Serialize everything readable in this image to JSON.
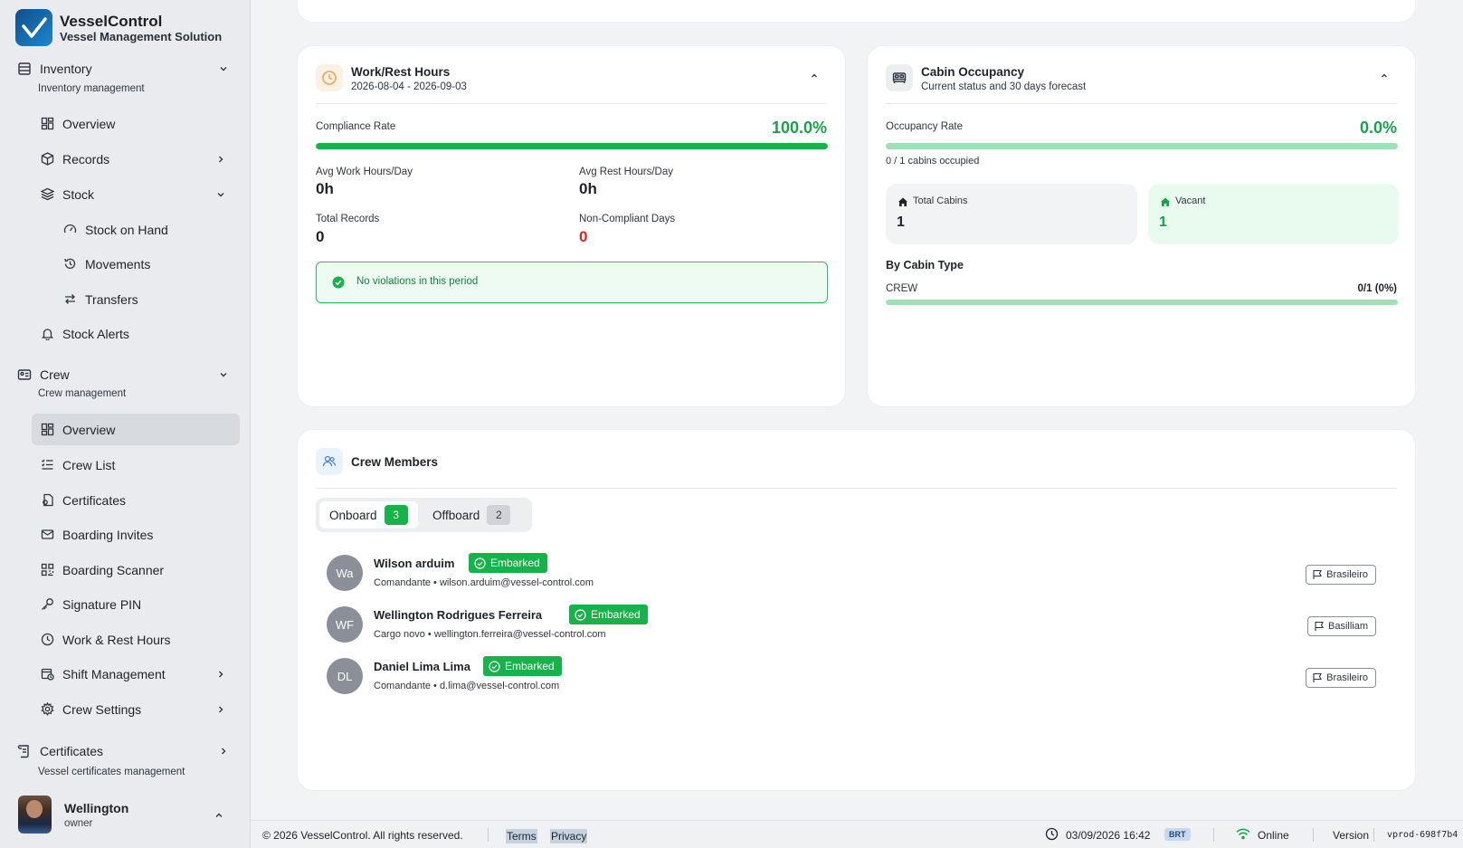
{
  "brand": {
    "name": "VesselControl",
    "subtitle": "Vessel Management Solution"
  },
  "sidebar": {
    "inventory": {
      "label": "Inventory",
      "subtitle": "Inventory management"
    },
    "inventory_items": {
      "overview": "Overview",
      "records": "Records",
      "stock": "Stock",
      "stock_on_hand": "Stock on Hand",
      "movements": "Movements",
      "transfers": "Transfers",
      "stock_alerts": "Stock Alerts"
    },
    "crew": {
      "label": "Crew",
      "subtitle": "Crew management"
    },
    "crew_items": {
      "overview": "Overview",
      "crew_list": "Crew List",
      "certificates": "Certificates",
      "boarding_invites": "Boarding Invites",
      "boarding_scanner": "Boarding Scanner",
      "signature_pin": "Signature PIN",
      "work_rest_hours": "Work & Rest Hours",
      "shift_management": "Shift Management",
      "crew_settings": "Crew Settings"
    },
    "certificates": {
      "label": "Certificates",
      "subtitle": "Vessel certificates management"
    },
    "user": {
      "name": "Wellington",
      "role": "owner"
    }
  },
  "work_rest": {
    "title": "Work/Rest Hours",
    "period": "2026-08-04 - 2026-09-03",
    "compliance_label": "Compliance Rate",
    "compliance_value": "100.0%",
    "compliance_fraction": 1.0,
    "avg_work_label": "Avg Work Hours/Day",
    "avg_work_value": "0h",
    "avg_rest_label": "Avg Rest Hours/Day",
    "avg_rest_value": "0h",
    "total_records_label": "Total Records",
    "total_records_value": "0",
    "non_compliant_label": "Non-Compliant Days",
    "non_compliant_value": "0",
    "status_message": "No violations in this period"
  },
  "cabin": {
    "title": "Cabin Occupancy",
    "subtitle": "Current status and 30 days forecast",
    "occupancy_label": "Occupancy Rate",
    "occupancy_value": "0.0%",
    "occupancy_fraction": 0.0,
    "occupied_text": "0 / 1 cabins occupied",
    "total_cabins_label": "Total Cabins",
    "total_cabins_value": "1",
    "vacant_label": "Vacant",
    "vacant_value": "1",
    "by_type_label": "By Cabin Type",
    "type_name": "CREW",
    "type_value": "0/1 (0%)"
  },
  "crew_members": {
    "title": "Crew Members",
    "tabs": [
      {
        "label": "Onboard",
        "count": "3"
      },
      {
        "label": "Offboard",
        "count": "2"
      }
    ],
    "members": [
      {
        "initials": "Wa",
        "name": "Wilson arduim",
        "status": "Embarked",
        "detail": "Comandante • wilson.arduim@vessel-control.com",
        "nationality": "Brasileiro"
      },
      {
        "initials": "WF",
        "name": "Wellington Rodrigues Ferreira",
        "status": "Embarked",
        "detail": "Cargo novo • wellington.ferreira@vessel-control.com",
        "nationality": "Basilliam"
      },
      {
        "initials": "DL",
        "name": "Daniel Lima Lima",
        "status": "Embarked",
        "detail": "Comandante • d.lima@vessel-control.com",
        "nationality": "Brasileiro"
      }
    ]
  },
  "footer": {
    "copyright": "© 2026 VesselControl. All rights reserved.",
    "terms": "Terms",
    "privacy": "Privacy",
    "datetime": "03/09/2026 16:42",
    "timezone": "BRT",
    "status": "Online",
    "version_label": "Version",
    "version_value": "vprod-698f7b4"
  },
  "colors": {
    "accent_green": "#16b24a",
    "danger_red": "#dc2626",
    "brand_blue": "#1e88d0"
  }
}
